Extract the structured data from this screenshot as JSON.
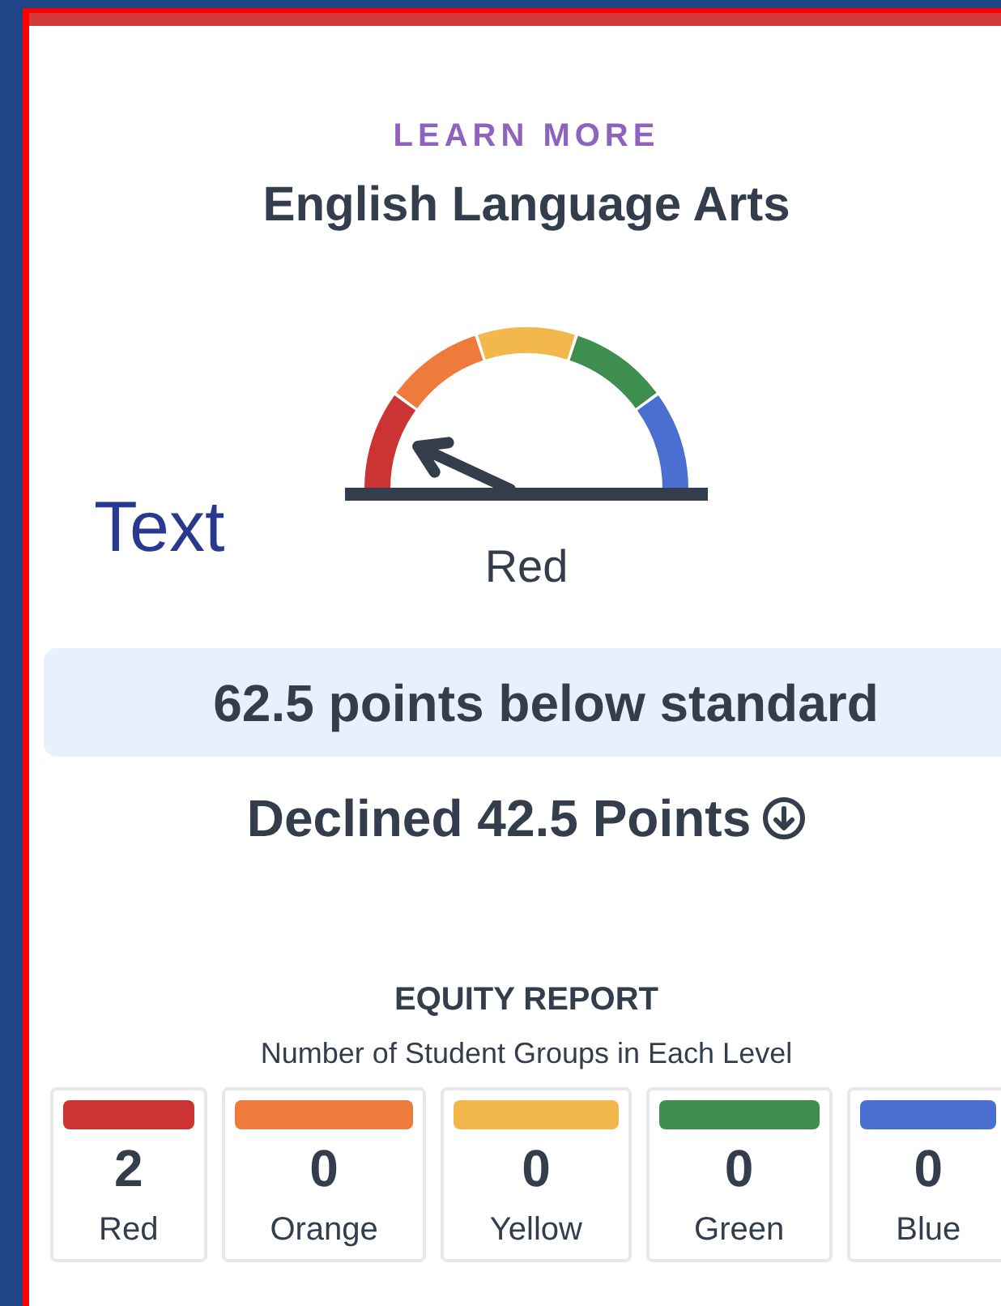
{
  "overlay_label": "Text",
  "link": "LEARN MORE",
  "title": "English Language Arts",
  "gauge": {
    "status": "Red"
  },
  "distance_banner": "62.5 points below standard",
  "change": {
    "text": "Declined 42.5 Points",
    "kind": "decline"
  },
  "equity_report": {
    "heading": "EQUITY REPORT",
    "subtitle": "Number of Student Groups in Each Level",
    "levels": [
      {
        "count": "2",
        "label": "Red",
        "color": "#cc3333"
      },
      {
        "count": "0",
        "label": "Orange",
        "color": "#ee7b3b"
      },
      {
        "count": "0",
        "label": "Yellow",
        "color": "#f2b84b"
      },
      {
        "count": "0",
        "label": "Green",
        "color": "#3e8e4f"
      },
      {
        "count": "0",
        "label": "Blue",
        "color": "#4a6fd1"
      }
    ]
  }
}
